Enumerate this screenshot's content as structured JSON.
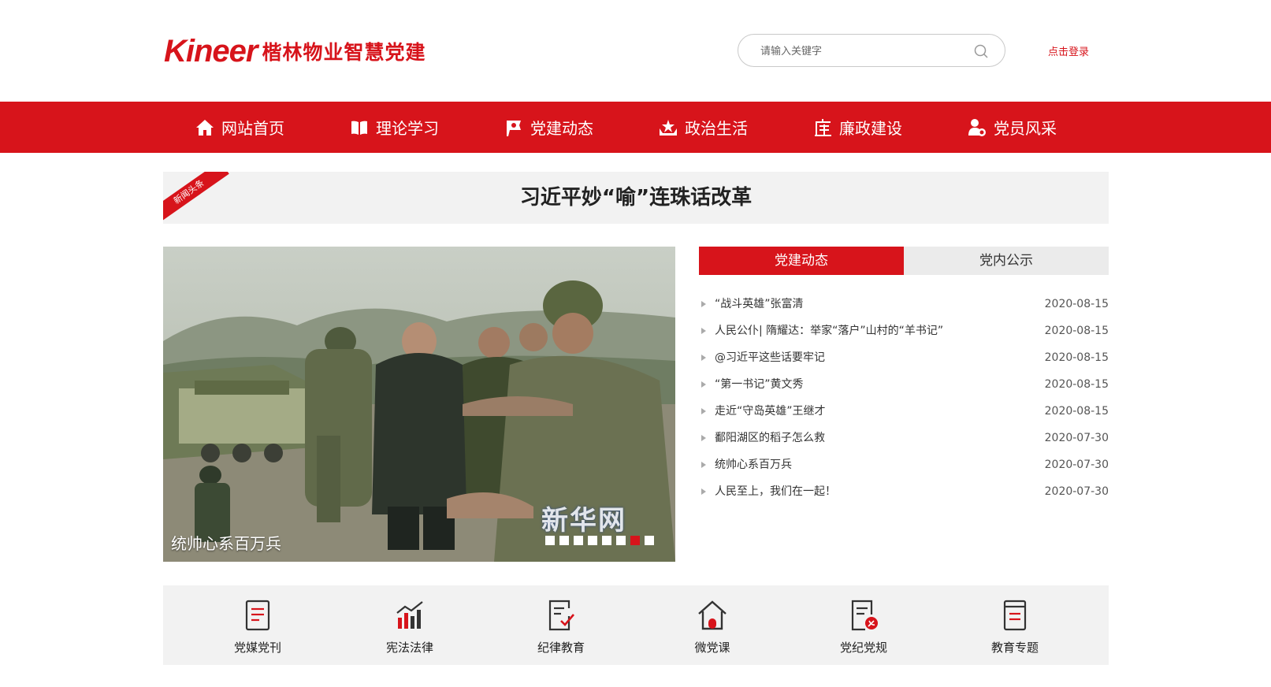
{
  "header": {
    "logo_mark": "Kineer",
    "logo_text": "楷林物业智慧党建",
    "search_placeholder": "请输入关键字",
    "login_label": "点击登录"
  },
  "nav": {
    "items": [
      {
        "label": "网站首页",
        "icon": "home-icon"
      },
      {
        "label": "理论学习",
        "icon": "book-icon"
      },
      {
        "label": "党建动态",
        "icon": "party-flag-icon"
      },
      {
        "label": "政治生活",
        "icon": "star-hands-icon"
      },
      {
        "label": "廉政建设",
        "icon": "lian-character-icon"
      },
      {
        "label": "党员风采",
        "icon": "member-badge-icon"
      }
    ]
  },
  "headline": {
    "ribbon": "新闻头条",
    "title": "习近平妙“喻”连珠话改革"
  },
  "carousel": {
    "caption": "统帅心系百万兵",
    "watermark": "新华网",
    "dot_count": 8,
    "active_dot": 7
  },
  "tabs": [
    {
      "label": "党建动态",
      "active": true
    },
    {
      "label": "党内公示",
      "active": false
    }
  ],
  "news": [
    {
      "title": "“战斗英雄”张富清",
      "date": "2020-08-15"
    },
    {
      "title": "人民公仆| 隋耀达：举家“落户”山村的“羊书记”",
      "date": "2020-08-15"
    },
    {
      "title": "@习近平这些话要牢记",
      "date": "2020-08-15"
    },
    {
      "title": "“第一书记”黄文秀",
      "date": "2020-08-15"
    },
    {
      "title": "走近“守岛英雄”王继才",
      "date": "2020-08-15"
    },
    {
      "title": "鄱阳湖区的稻子怎么救",
      "date": "2020-07-30"
    },
    {
      "title": "统帅心系百万兵",
      "date": "2020-07-30"
    },
    {
      "title": "人民至上，我们在一起！",
      "date": "2020-07-30"
    }
  ],
  "iconbar": {
    "items": [
      {
        "label": "党媒党刊",
        "icon": "document-icon"
      },
      {
        "label": "宪法法律",
        "icon": "bar-chart-icon"
      },
      {
        "label": "纪律教育",
        "icon": "checklist-icon"
      },
      {
        "label": "微党课",
        "icon": "house-icon"
      },
      {
        "label": "党纪党规",
        "icon": "party-document-icon"
      },
      {
        "label": "教育专题",
        "icon": "notebook-icon"
      }
    ]
  },
  "colors": {
    "brand_red": "#d7141b",
    "panel_gray": "#f2f2f2"
  }
}
